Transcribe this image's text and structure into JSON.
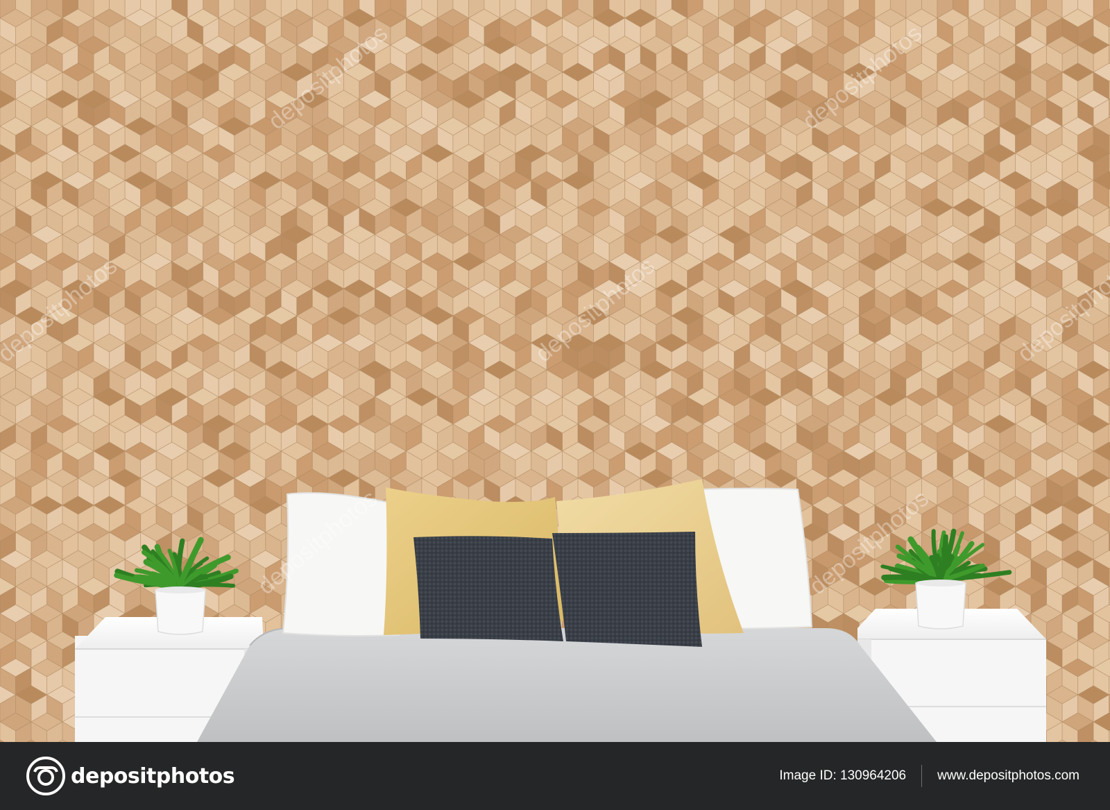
{
  "scene": {
    "wall_color": "#d9b48f",
    "bedding_color": "#c9cbcd",
    "pillow_white": "#f7f7f5",
    "pillow_yellow": "#e3c57a",
    "pillow_dark": "#3a3f47",
    "nightstand_color": "#fafafa",
    "plant_color": "#3f9a2c",
    "watermark_text": "depositphotos"
  },
  "footer": {
    "brand": "depositphotos",
    "image_id": "Image ID: 130964206",
    "site": "www.depositphotos.com"
  }
}
